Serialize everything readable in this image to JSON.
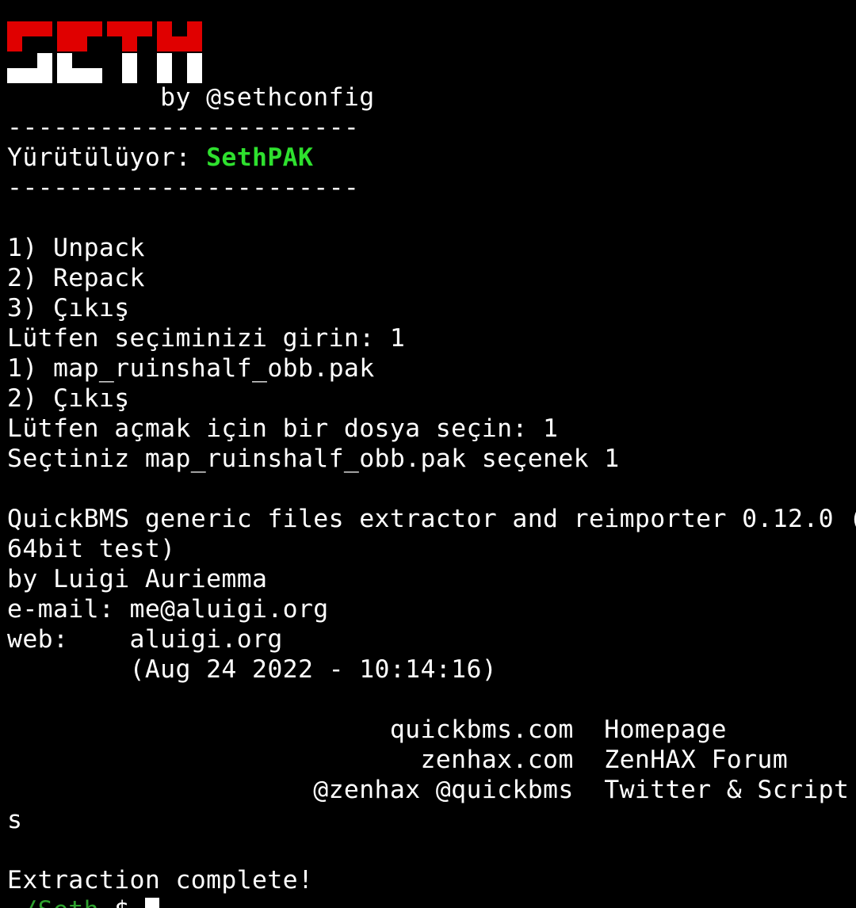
{
  "terminal": {
    "logo_text": "SETH",
    "colors": {
      "background": "#000000",
      "text": "#ffffff",
      "logo_top": "#e00000",
      "logo_bottom": "#ffffff",
      "highlight": "#2ee02e",
      "prompt": "#2ea12e"
    },
    "byline": "          by @sethconfig",
    "separator_top": "-----------------------",
    "running_label": "Yürütülüyor: ",
    "running_value": "SethPAK",
    "separator_bottom": "-----------------------",
    "menu": [
      "1) Unpack",
      "2) Repack",
      "3) Çıkış"
    ],
    "menu_prompt": "Lütfen seçiminizi girin: 1",
    "files": [
      "1) map_ruinshalf_obb.pak",
      "2) Çıkış"
    ],
    "file_prompt": "Lütfen açmak için bir dosya seçin: 1",
    "selection_result": "Seçtiniz map_ruinshalf_obb.pak seçenek 1",
    "quickbms": {
      "title_line1": "QuickBMS generic files extractor and reimporter 0.12.0 (",
      "title_line2": "64bit test)",
      "author": "by Luigi Auriemma",
      "email": "e-mail: me@aluigi.org",
      "web": "web:    aluigi.org",
      "date": "        (Aug 24 2022 - 10:14:16)",
      "links": [
        "                         quickbms.com  Homepage",
        "                           zenhax.com  ZenHAX Forum",
        "                    @zenhax @quickbms  Twitter & Script",
        "s"
      ]
    },
    "status": "Extraction complete!",
    "prompt_path": "~/Seth",
    "prompt_symbol": " $ "
  }
}
